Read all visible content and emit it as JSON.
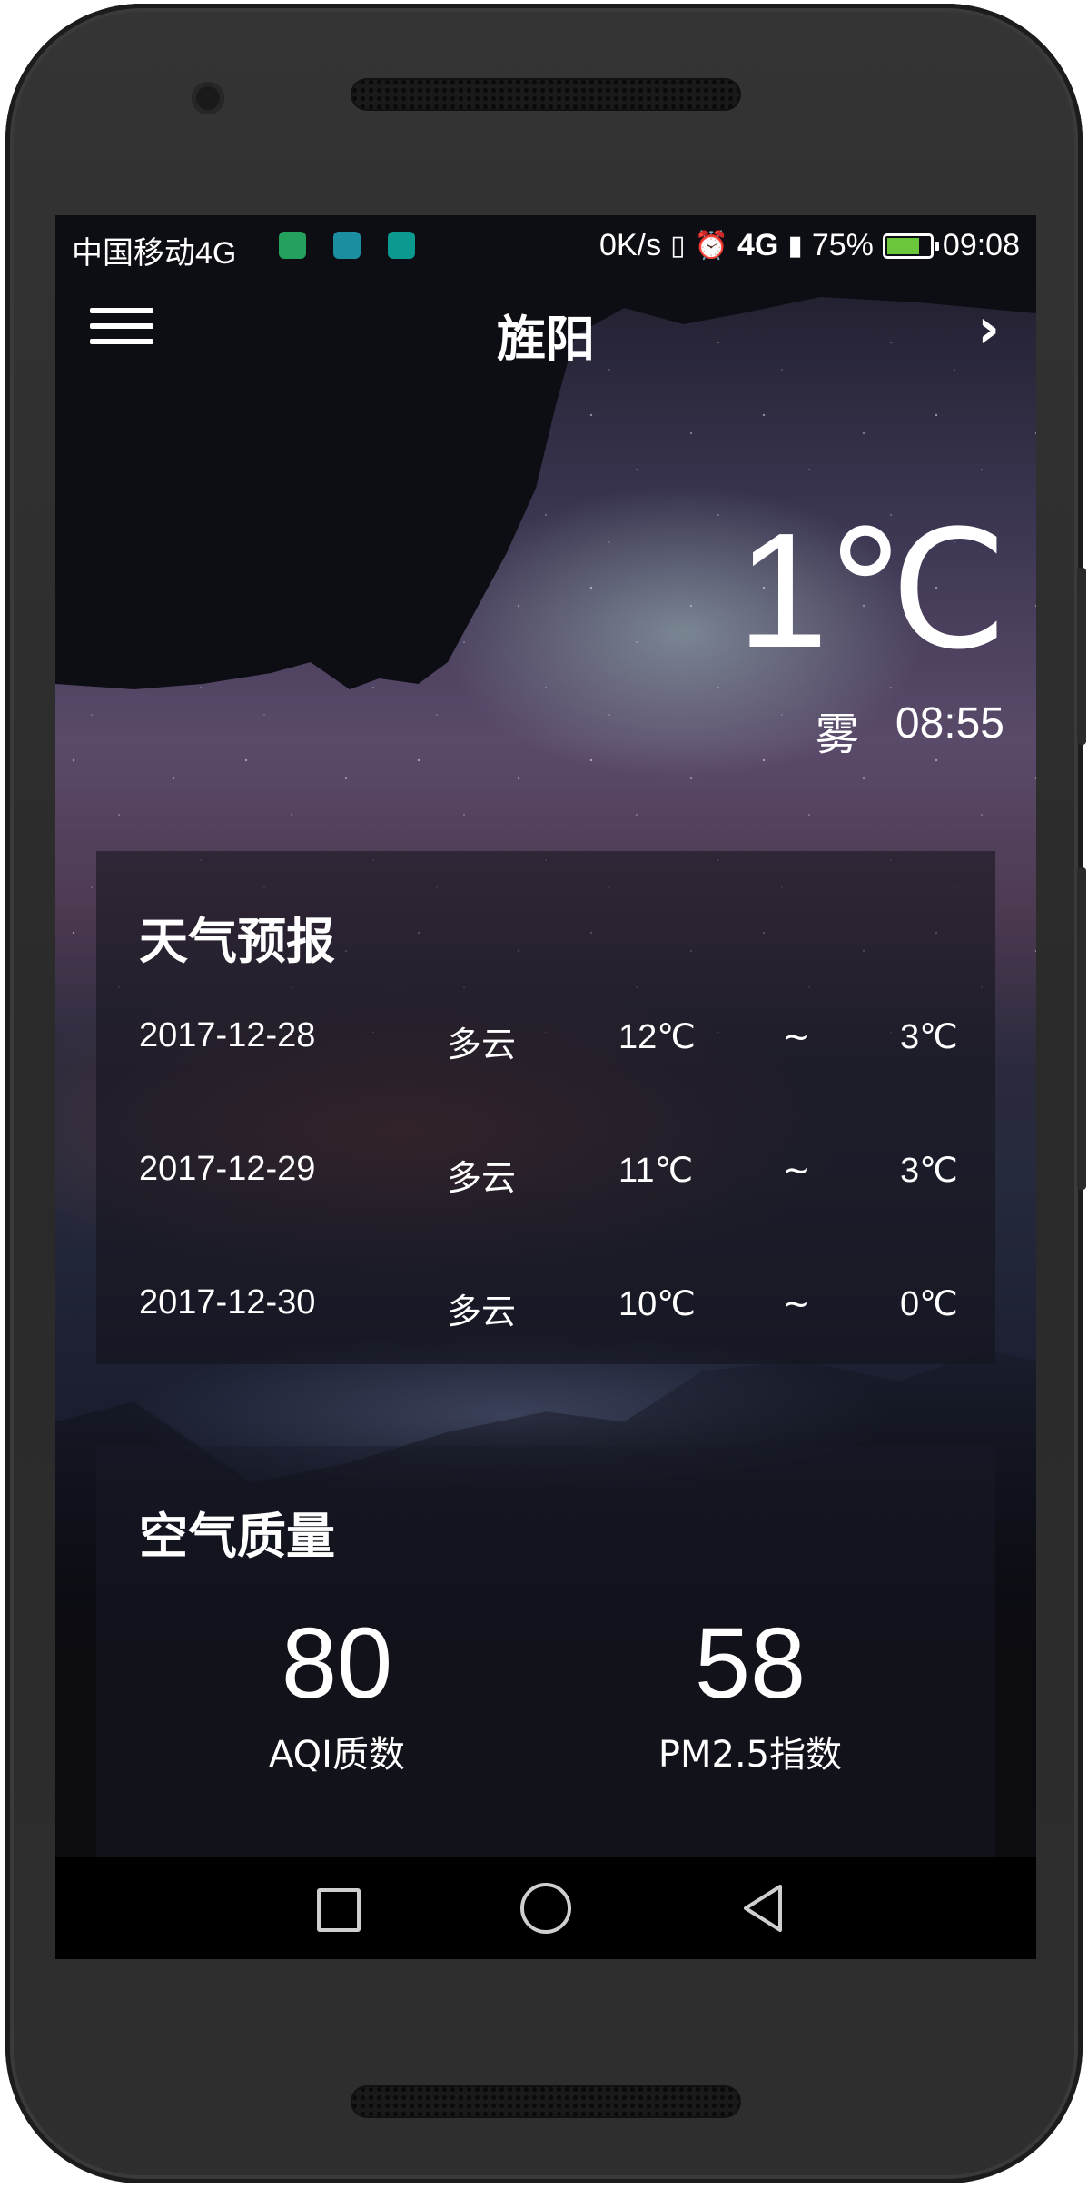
{
  "status_bar": {
    "carrier": "中国移动4G",
    "speed": "0K/s",
    "network": "4G",
    "battery": "75%",
    "battery_fraction": 0.75,
    "time": "09:08",
    "icons": [
      "shopping-bag-icon",
      "android-icon",
      "app-icon",
      "vibrate-icon",
      "alarm-icon",
      "signal-icon",
      "battery-icon"
    ],
    "notif_colors": [
      "#23a05b",
      "#1b8fa0",
      "#0c9a90"
    ]
  },
  "header": {
    "city": "旌阳",
    "menu_icon": "menu-icon",
    "next_icon": "chevron-right-icon"
  },
  "now": {
    "temperature": "1℃",
    "condition": "雾",
    "update_time": "08:55"
  },
  "forecast": {
    "title": "天气预报",
    "rows": [
      {
        "date": "2017-12-28",
        "condition": "多云",
        "max": "12℃",
        "separator": "~",
        "min": "3℃"
      },
      {
        "date": "2017-12-29",
        "condition": "多云",
        "max": "11℃",
        "separator": "~",
        "min": "3℃"
      },
      {
        "date": "2017-12-30",
        "condition": "多云",
        "max": "10℃",
        "separator": "~",
        "min": "0℃"
      }
    ]
  },
  "aqi": {
    "title": "空气质量",
    "aqi_value": "80",
    "aqi_label": "AQI质数",
    "pm25_value": "58",
    "pm25_label": "PM2.5指数"
  },
  "navigation": {
    "icons": [
      "recent-apps-icon",
      "home-icon",
      "back-icon"
    ]
  }
}
